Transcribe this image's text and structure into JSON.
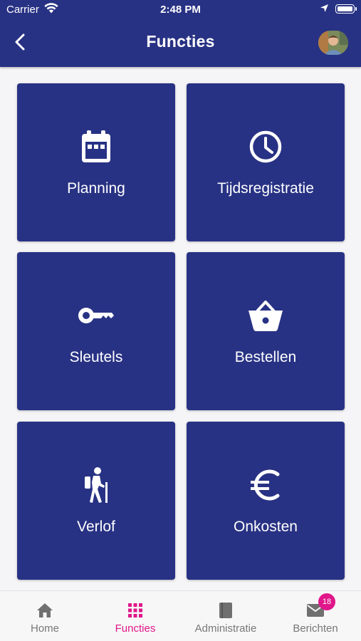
{
  "status_bar": {
    "carrier": "Carrier",
    "time": "2:48 PM"
  },
  "header": {
    "title": "Functies"
  },
  "tiles": [
    {
      "label": "Planning",
      "icon": "calendar-icon"
    },
    {
      "label": "Tijdsregistratie",
      "icon": "clock-icon"
    },
    {
      "label": "Sleutels",
      "icon": "key-icon"
    },
    {
      "label": "Bestellen",
      "icon": "basket-icon"
    },
    {
      "label": "Verlof",
      "icon": "hiking-icon"
    },
    {
      "label": "Onkosten",
      "icon": "euro-icon"
    }
  ],
  "tabbar": {
    "items": [
      {
        "label": "Home",
        "icon": "home-icon",
        "active": false
      },
      {
        "label": "Functies",
        "icon": "apps-grid-icon",
        "active": true
      },
      {
        "label": "Administratie",
        "icon": "book-icon",
        "active": false
      },
      {
        "label": "Berichten",
        "icon": "mail-icon",
        "active": false
      }
    ],
    "messages_badge": "18"
  },
  "colors": {
    "primary": "#283284",
    "accent": "#e0168a",
    "background": "#f5f5f7",
    "tab_inactive": "#777777"
  }
}
